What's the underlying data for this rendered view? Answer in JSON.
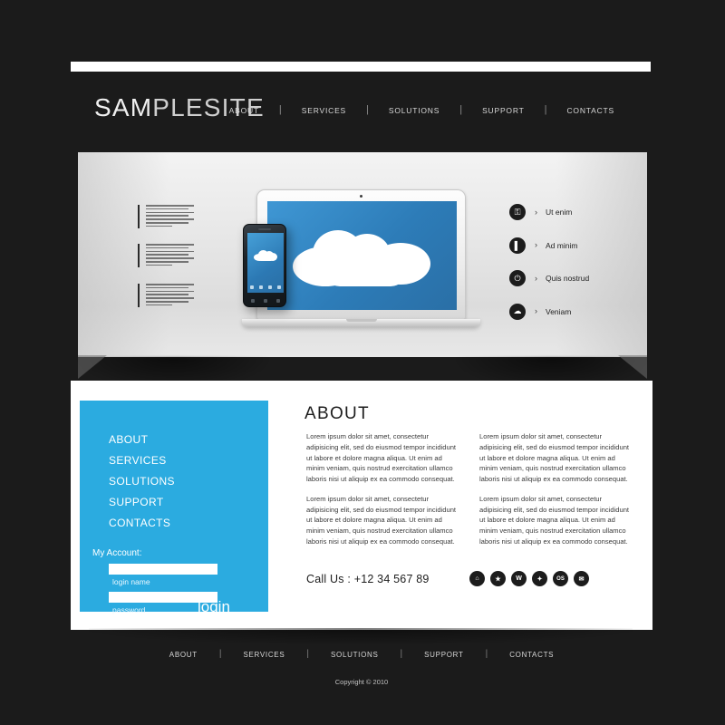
{
  "site": {
    "logo_primary": "SAM",
    "logo_secondary": "PLESITE"
  },
  "top_nav": {
    "separator": "|",
    "items": [
      {
        "label": "ABOUT"
      },
      {
        "label": "SERVICES"
      },
      {
        "label": "SOLUTIONS"
      },
      {
        "label": "SUPPORT"
      },
      {
        "label": "CONTACTS"
      }
    ]
  },
  "hero": {
    "device_icon": "laptop-with-cloud",
    "phone_icon": "smartphone-with-cloud",
    "features": [
      {
        "label": "Ut enim",
        "icon": "lock-icon",
        "glyph": "⚿",
        "arrow": "›"
      },
      {
        "label": "Ad minim",
        "icon": "book-icon",
        "glyph": "▌",
        "arrow": "›"
      },
      {
        "label": "Quis nostrud",
        "icon": "power-icon",
        "glyph": "⏻",
        "arrow": "›"
      },
      {
        "label": "Veniam",
        "icon": "cloud-icon",
        "glyph": "☁",
        "arrow": "›"
      }
    ]
  },
  "sidebar": {
    "items": [
      {
        "label": "ABOUT"
      },
      {
        "label": "SERVICES"
      },
      {
        "label": "SOLUTIONS"
      },
      {
        "label": "SUPPORT"
      },
      {
        "label": "CONTACTS"
      }
    ],
    "account_label": "My Account:",
    "login_name_value": "",
    "login_name_placeholder": "",
    "login_name_caption": "login name",
    "password_value": "",
    "password_placeholder": "",
    "password_caption": "password",
    "login_button": "login"
  },
  "about": {
    "heading": "ABOUT",
    "columns": [
      {
        "paragraphs": [
          "Lorem ipsum dolor sit amet, consectetur adipisicing elit, sed do eiusmod tempor incididunt ut labore et dolore magna aliqua. Ut enim ad minim veniam, quis nostrud exercitation ullamco laboris nisi ut aliquip ex ea commodo consequat.",
          "Lorem ipsum dolor sit amet, consectetur adipisicing elit, sed do eiusmod tempor incididunt ut labore et dolore magna aliqua. Ut enim ad minim veniam, quis nostrud exercitation ullamco laboris nisi ut aliquip ex ea commodo consequat."
        ]
      },
      {
        "paragraphs": [
          "Lorem ipsum dolor sit amet, consectetur adipisicing elit, sed do eiusmod tempor incididunt ut labore et dolore magna aliqua. Ut enim ad minim veniam, quis nostrud exercitation ullamco laboris nisi ut aliquip ex ea commodo consequat.",
          "Lorem ipsum dolor sit amet, consectetur adipisicing elit, sed do eiusmod tempor incididunt ut labore et dolore magna aliqua. Ut enim ad minim veniam, quis nostrud exercitation ullamco laboris nisi ut aliquip ex ea commodo consequat."
        ]
      }
    ],
    "call_us": "Call Us : +12 34 567 89",
    "social": [
      {
        "icon": "home-icon",
        "glyph": "⌂"
      },
      {
        "icon": "star-icon",
        "glyph": "★"
      },
      {
        "icon": "wordpress-icon",
        "glyph": "W"
      },
      {
        "icon": "compass-icon",
        "glyph": "✦"
      },
      {
        "icon": "os-icon",
        "glyph": "OS"
      },
      {
        "icon": "mail-icon",
        "glyph": "✉"
      }
    ]
  },
  "footer": {
    "separator": "|",
    "items": [
      {
        "label": "ABOUT"
      },
      {
        "label": "SERVICES"
      },
      {
        "label": "SOLUTIONS"
      },
      {
        "label": "SUPPORT"
      },
      {
        "label": "CONTACTS"
      }
    ],
    "copyright": "Copyright © 2010"
  },
  "colors": {
    "background": "#1b1b1b",
    "accent_blue": "#2babe0",
    "screen_blue": "#2d7cb8",
    "panel_white": "#ffffff",
    "badge_dark": "#1c1c1c"
  }
}
